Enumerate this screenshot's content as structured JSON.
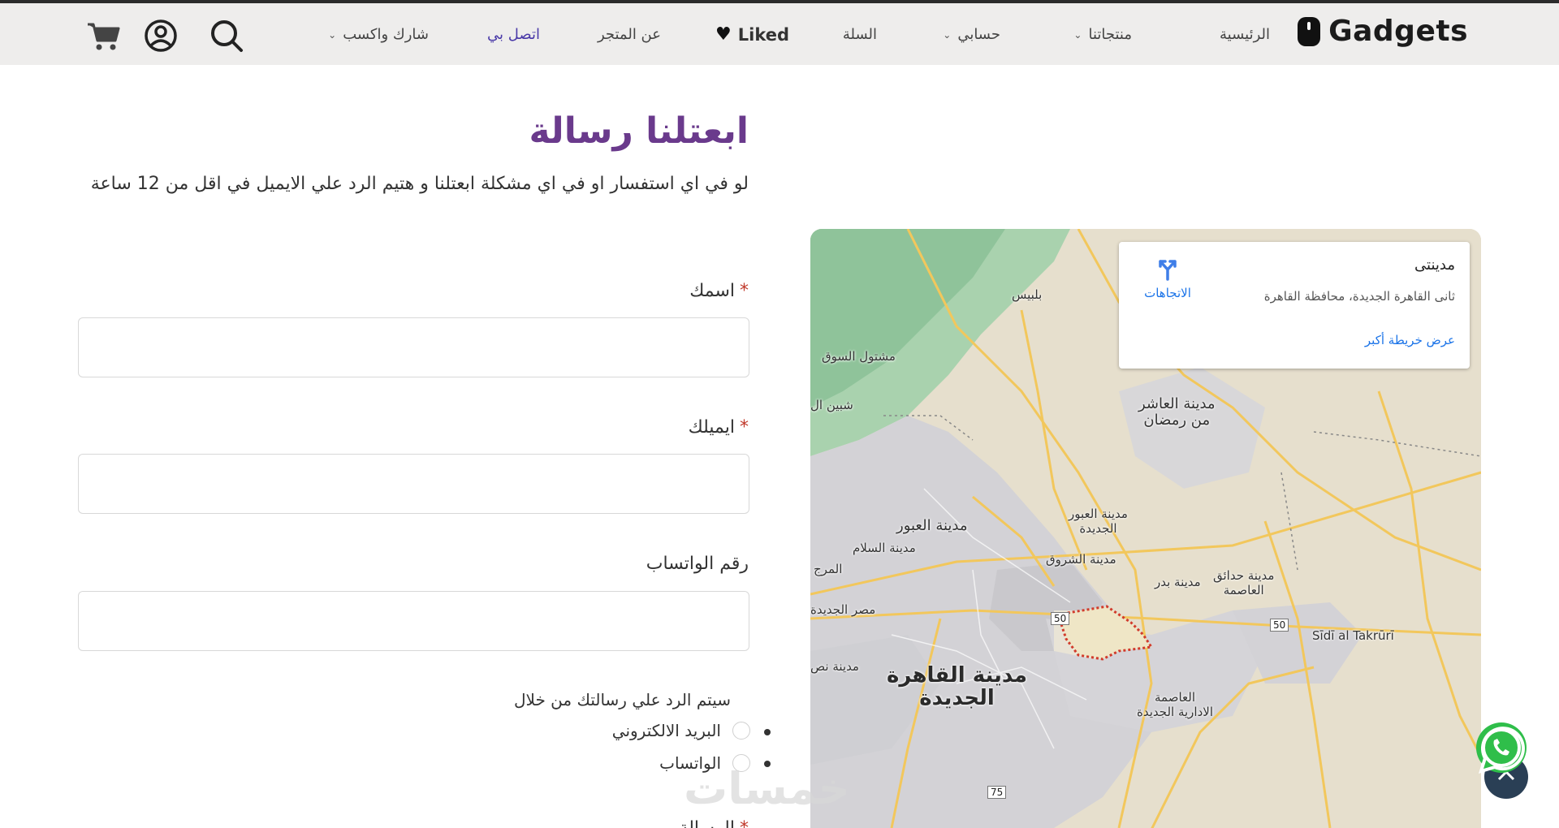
{
  "header": {
    "logo_text": "Gadgets",
    "nav": {
      "home": "الرئيسية",
      "products": "منتجاتنا",
      "account": "حسابي",
      "cart": "السلة",
      "liked": "Liked",
      "about": "عن المتجر",
      "contact": "اتصل بي",
      "share": "شارك واكسب"
    },
    "active_color": "#4a3aa8",
    "icons": [
      "search-icon",
      "user-circle-icon",
      "cart-icon",
      "heart-icon",
      "chevron-down-icon"
    ]
  },
  "contact": {
    "title": "ابعتلنا رسالة",
    "description": "لو في اي استفسار او في اي مشكلة ابعتلنا و هتيم الرد علي الايميل في اقل من 12 ساعة",
    "title_color": "#6a3a8c",
    "fields": {
      "name_label": "اسمك",
      "email_label": "ايميلك",
      "whatsapp_label": "رقم الواتساب",
      "required_mark": "*",
      "name_value": "",
      "email_value": "",
      "whatsapp_value": ""
    },
    "reply_prompt": "سيتم الرد علي رسالتك من خلال",
    "reply_options": [
      "البريد الالكتروني",
      "الواتساب"
    ],
    "message_label": "الرسالة"
  },
  "map": {
    "card": {
      "title": "مدينتى",
      "address": "ثانى القاهرة الجديدة، محافظة القاهرة",
      "directions": "الاتجاهات",
      "larger_map": "عرض خريطة أكبر"
    },
    "labels": {
      "bilbeis": "بلبيس",
      "mashtoul": "مشتول السوق",
      "shibin": "شبين ال",
      "tenth": "مدينة العاشر\nمن رمضان",
      "obour_new": "مدينة العبور\nالجديدة",
      "obour": "مدينة العبور",
      "salam": "مدينة السلام",
      "marg": "المرج",
      "shorouk": "مدينة الشروق",
      "badr": "مدينة بدر",
      "capital_gardens": "مدينة حدائق\nالعاصمة",
      "masr_new": "مصر الجديدة",
      "nasr": "مدينة نص",
      "new_cairo": "مدينة القاهرة\nالجديدة",
      "new_admin": "العاصمة\nالادارية الجديدة",
      "sidi": "Sīdī al Takrūrī",
      "road_50a": "50",
      "road_50b": "50",
      "road_75": "75"
    }
  },
  "watermark": "خمسات"
}
